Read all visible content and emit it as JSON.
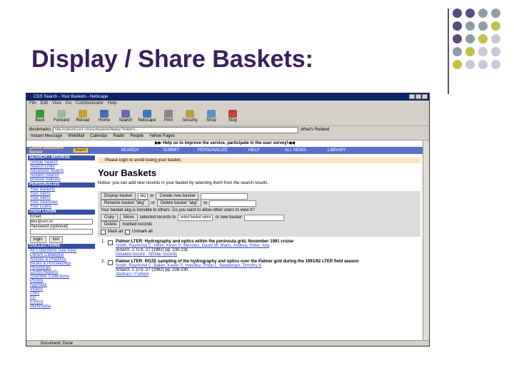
{
  "slide": {
    "title": "Display / Share Baskets:",
    "dot_colors": [
      "#5b4a7a",
      "#8e9fa3",
      "#c2c24a",
      "#c8c8d8"
    ]
  },
  "browser": {
    "window_title": "CDS Search - Your Baskets - Netscape",
    "menu": [
      "File",
      "Edit",
      "View",
      "Go",
      "Communicator",
      "Help"
    ],
    "toolbar": [
      "Back",
      "Forward",
      "Reload",
      "Home",
      "Search",
      "Netscape",
      "Print",
      "Security",
      "Shop",
      "Stop"
    ],
    "location_label": "Bookmarks",
    "location_url": "http://cdsweb.cern.ch/yourbaskets/display?bskid=1...",
    "related_label": "What's Related",
    "personal": [
      "Instant Message",
      "WebMail",
      "Calendar",
      "Radio",
      "People",
      "Yellow Pages"
    ],
    "status": "Document: Done"
  },
  "page": {
    "survey": "▶▶ Help us to improve the service, participate in the user survey!◀◀",
    "logo": "CERN Document Server",
    "search_badge": "Search",
    "nav": [
      "SEARCH",
      "SUBMIT",
      "PERSONALIZE",
      "HELP",
      "ALL NEWS",
      "LIBRARY"
    ],
    "sidebar": {
      "search_header": "SEARCH / BROWSE",
      "search_links": [
        "Simple Search",
        "Search Links",
        "Advanced Search",
        "Subject Search",
        "Browse Indexes"
      ],
      "personal_header": "PERSONALIZE",
      "personal_links": [
        "Your Baskets",
        "Your Alerts",
        "Your Alerts",
        "Your Searches",
        "Your Loans"
      ],
      "login_header": "USER LOGIN",
      "email_label": "Email:",
      "email_value": "tibor@cern.ch",
      "password_label": "Password (optional):",
      "login_button": "login",
      "lost_button": "lost",
      "collections_header": "COLLECTIONS",
      "collections": [
        "All Collections (see tree)",
        "Library Catalogue",
        "Articles & Preprints",
        "Books & Proceedings",
        "Periodicals",
        "CERN Reports",
        "Scientific Collections",
        "Photos",
        "Agendas",
        "Videos",
        "CMS",
        "EP",
        "E-Print",
        "Multimedia"
      ]
    },
    "main": {
      "info": "Please login to avoid losing your basket.",
      "heading": "Your Baskets",
      "notice": "Notice: you can add new records in your basket by selecting them from the search results.",
      "display_basket_btn": "Display basket",
      "basket_select": "akg",
      "or1": "or",
      "create_btn": "Create new basket",
      "rename_btn": "Rename basket \"akg\"",
      "or2": "or",
      "delete_basket_btn": "Delete basket \"akg\"",
      "to": "to",
      "invisible": "Your basket akg is invisible to others. Do you want to allow other users to view it?",
      "copy_btn": "Copy",
      "move_btn": "Move",
      "selected_records": "selected records to",
      "target_select": "select basket name",
      "or_new": "or new basket",
      "delete_btn": "Delete",
      "marked_records": "marked records",
      "mark_all": "Mark all",
      "unmark_all": "Unmark all",
      "records": [
        {
          "n": "1.",
          "title": "Palmer LTER: Hydrography and optics within the peninsula grid, November 1991 cruise",
          "authors": "Smith, Raymond C; Helm, Kevin P; Menzies, David W; Marin, Andrea; Hofer, Ana",
          "links": "Detailed record - Similar records",
          "ref": "Antarct. J. U.S. 27 (1992) pp. 230-231"
        },
        {
          "n": "2.",
          "title": "Palmer LTER: ROZE sampling of the hydrography and optics over the Palmer grid during the 1991/92 LTER field season",
          "authors": "Smith, Raymond C; Baker, Karen S; Handley, Philip L; Newberger, Timothy K",
          "links": "Abstract / Fulltext",
          "ref": "Antarct. J. U.S. 27 (1992) pp. 228-230"
        }
      ]
    }
  }
}
